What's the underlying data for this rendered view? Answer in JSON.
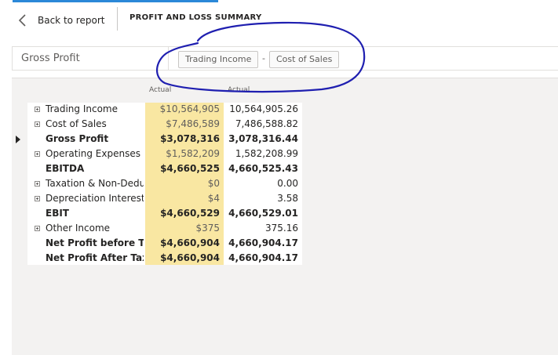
{
  "header": {
    "back_label": "Back to report",
    "page_title": "PROFIT AND LOSS SUMMARY"
  },
  "formula": {
    "measure": "Gross Profit",
    "term1": "Trading Income",
    "operator": "-",
    "term2": "Cost of Sales"
  },
  "matrix": {
    "columns": [
      "Actual",
      "Actual"
    ],
    "rows": [
      {
        "label": "Trading Income",
        "v1": "$10,564,905",
        "v2": "10,564,905.26"
      },
      {
        "label": "Cost of Sales",
        "v1": "$7,486,589",
        "v2": "7,486,588.82"
      },
      {
        "label": "Gross Profit",
        "v1": "$3,078,316",
        "v2": "3,078,316.44"
      },
      {
        "label": "Operating Expenses",
        "v1": "$1,582,209",
        "v2": "1,582,208.99"
      },
      {
        "label": "EBITDA",
        "v1": "$4,660,525",
        "v2": "4,660,525.43"
      },
      {
        "label": "Taxation & Non-Dedu",
        "v1": "$0",
        "v2": "0.00"
      },
      {
        "label": "Depreciation Interest",
        "v1": "$4",
        "v2": "3.58"
      },
      {
        "label": "EBIT",
        "v1": "$4,660,529",
        "v2": "4,660,529.01"
      },
      {
        "label": "Other Income",
        "v1": "$375",
        "v2": "375.16"
      },
      {
        "label": "Net Profit before Tax",
        "v1": "$4,660,904",
        "v2": "4,660,904.17"
      },
      {
        "label": "Net Profit After Tax",
        "v1": "$4,660,904",
        "v2": "4,660,904.17"
      }
    ]
  },
  "colors": {
    "highlight": "#f9e7a2",
    "annotation": "#1f1fb0",
    "accent": "#2b88d8"
  },
  "icons": [
    "chevron-left-icon",
    "expand-plus-icon",
    "row-pointer-icon"
  ]
}
